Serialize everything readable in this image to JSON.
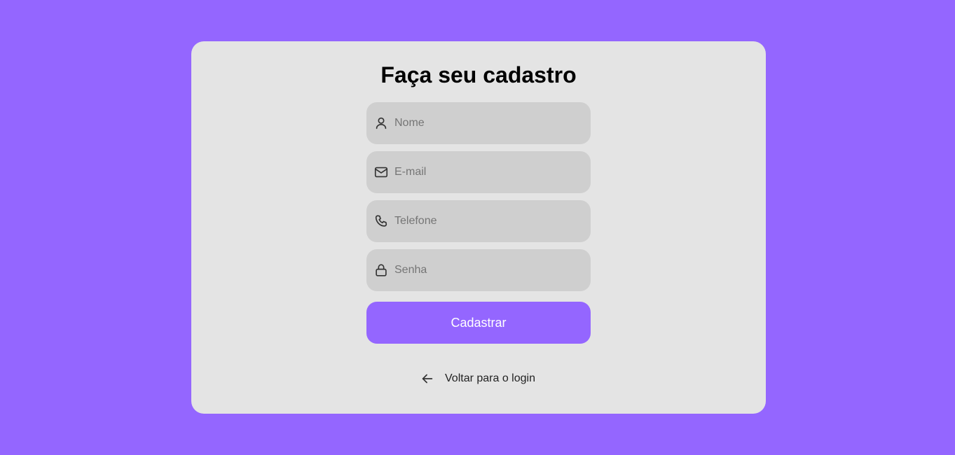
{
  "page": {
    "background_color": "#9466ff",
    "card_color": "#e4e4e4"
  },
  "form": {
    "title": "Faça seu cadastro",
    "fields": [
      {
        "icon": "user-icon",
        "placeholder": "Nome",
        "value": ""
      },
      {
        "icon": "mail-icon",
        "placeholder": "E-mail",
        "value": ""
      },
      {
        "icon": "phone-icon",
        "placeholder": "Telefone",
        "value": ""
      },
      {
        "icon": "lock-icon",
        "placeholder": "Senha",
        "value": ""
      }
    ],
    "submit_label": "Cadastrar",
    "back_link": {
      "icon": "arrow-left-icon",
      "label": "Voltar para o login"
    }
  }
}
